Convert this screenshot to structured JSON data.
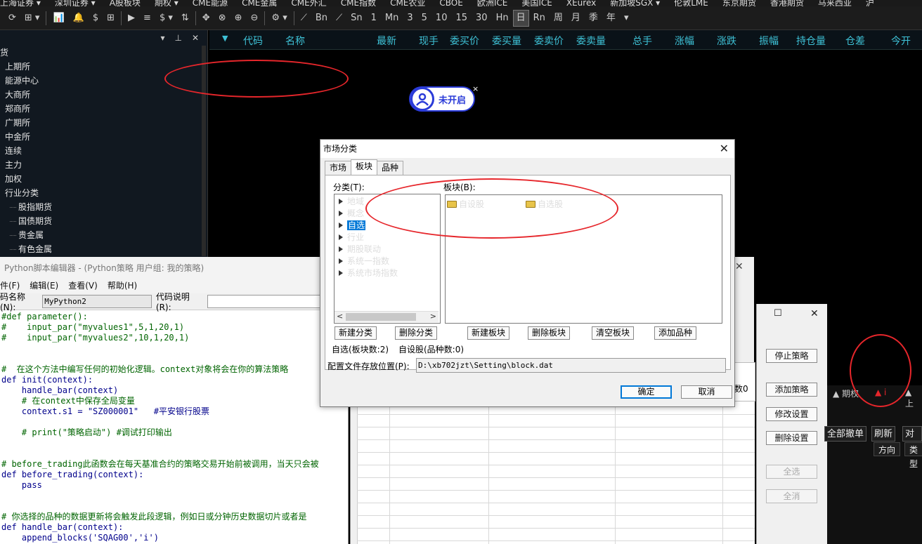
{
  "market_bar": [
    "上海证券 ▾",
    "深圳证券 ▾",
    "A股板块",
    "期权 ▾",
    "CME能源",
    "CME金属",
    "CME外汇",
    "CME指数",
    "CME农业",
    "CBOE",
    "欧洲ICE",
    "美国ICE",
    "XEurex",
    "新加坡SGX ▾",
    "伦敦LME",
    "东京期货",
    "香港期货",
    "马来西亚",
    "沪"
  ],
  "toolbar": {
    "buttons": [
      "⟳",
      "⊞ ▾",
      "|",
      "📊",
      "🔔",
      "$",
      "⊞",
      "|",
      "▶",
      "≡",
      "$ ▾",
      "⇅",
      "|",
      "✥",
      "⊗",
      "⊕",
      "⊖",
      "|",
      "⚙ ▾",
      "|",
      "⟋",
      "Bn",
      "⟋",
      "Sn",
      "1",
      "Mn",
      "3",
      "5",
      "10",
      "15",
      "30",
      "Hn",
      "日",
      "Rn",
      "周",
      "月",
      "季",
      "年",
      "▾"
    ],
    "active": "日"
  },
  "left_panel": {
    "head_icons": [
      "▾",
      "⊥",
      "✕"
    ],
    "items": [
      {
        "label": "货",
        "level": 0
      },
      {
        "label": "上期所",
        "level": 1
      },
      {
        "label": "能源中心",
        "level": 1
      },
      {
        "label": "大商所",
        "level": 1
      },
      {
        "label": "郑商所",
        "level": 1
      },
      {
        "label": "广期所",
        "level": 1
      },
      {
        "label": "中金所",
        "level": 1
      },
      {
        "label": "连续",
        "level": 1
      },
      {
        "label": "主力",
        "level": 1
      },
      {
        "label": "加权",
        "level": 1
      },
      {
        "label": "行业分类",
        "level": 1
      },
      {
        "label": "股指期货",
        "level": 2
      },
      {
        "label": "国债期货",
        "level": 2
      },
      {
        "label": "贵金属",
        "level": 2
      },
      {
        "label": "有色金属",
        "level": 2
      }
    ]
  },
  "quote_header": {
    "columns": [
      "代码",
      "名称",
      "最新",
      "现手",
      "委买价",
      "委买量",
      "委卖价",
      "委卖量",
      "总手",
      "涨幅",
      "涨跌",
      "振幅",
      "持仓量",
      "仓差",
      "今开"
    ]
  },
  "badge": {
    "label": "未开启",
    "close": "×"
  },
  "python_editor": {
    "title": "Python脚本编辑器 - (Python策略 用户组: 我的策略)",
    "menu": [
      "件(F)",
      "编辑(E)",
      "查看(V)",
      "帮助(H)"
    ],
    "name_label": "码名称(N):",
    "name_value": "MyPython2",
    "desc_label": "代码说明(R):",
    "code": [
      "#def parameter():",
      "#    input_par(\"myvalues1\",5,1,20,1)",
      "#    input_par(\"myvalues2\",10,1,20,1)",
      "",
      "",
      "#  在这个方法中编写任何的初始化逻辑。context对象将会在你的算法策略",
      "def init(context):",
      "    handle_bar(context)",
      "    # 在context中保存全局变量",
      "    context.s1 = \"SZ000001\"   #平安银行股票",
      "",
      "    # print(\"策略启动\") #调试打印输出",
      "",
      "",
      "# before_trading此函数会在每天基准合约的策略交易开始前被调用，当天只会被",
      "def before_trading(context):",
      "    pass",
      "",
      "",
      "# 你选择的品种的数据更新将会触发此段逻辑，例如日或分钟历史数据切片或者是",
      "def handle_bar(context):",
      "    append_blocks('SQAG00','i')"
    ]
  },
  "strategy_window": {
    "close": "✕",
    "side_controls": [
      "☐",
      "✕"
    ],
    "side_buttons": [
      {
        "label": "停止策略",
        "enabled": true
      },
      {
        "label": "添加策略",
        "enabled": true
      },
      {
        "label": "修改设置",
        "enabled": true
      },
      {
        "label": "删除设置",
        "enabled": true
      },
      {
        "label": "全选",
        "enabled": false
      },
      {
        "label": "全消",
        "enabled": false
      }
    ],
    "partial_text": "数0"
  },
  "right_dark": {
    "tabs": [
      "▲ 期权",
      "▲ i",
      "▲ 上"
    ],
    "buttons": [
      "全部撤单",
      "刷新",
      "对价"
    ],
    "headers": [
      "方向",
      "类型"
    ]
  },
  "dialog": {
    "title": "市场分类",
    "close": "✕",
    "tabs": [
      "市场",
      "板块",
      "品种"
    ],
    "active_tab": "板块",
    "category_label": "分类(T):",
    "block_label": "板块(B):",
    "categories": [
      "地域",
      "概念",
      "自选",
      "行业",
      "期股联动",
      "系统一指数",
      "系统市场指数"
    ],
    "selected_category": "自选",
    "blocks": [
      "自设股",
      "自选股"
    ],
    "buttons": [
      "新建分类",
      "删除分类",
      "新建板块",
      "删除板块",
      "清空板块",
      "添加品种"
    ],
    "status_left": "自选(板块数:2)",
    "status_right": "自设股(品种数:0)",
    "path_label": "配置文件存放位置(P):",
    "path_value": "D:\\xb702jzt\\Setting\\block.dat",
    "ok": "确定",
    "cancel": "取消"
  },
  "colors": {
    "quote_header_text": "#3ec1d6",
    "annotation": "#e6262b",
    "badge": "#2a3bd8",
    "selection": "#0078d7"
  }
}
